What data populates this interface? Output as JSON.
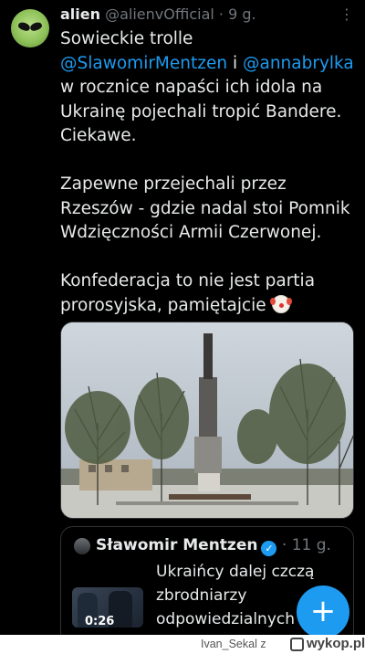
{
  "tweet": {
    "display_name": "alien",
    "handle": "@alienvOfficial",
    "separator": " · ",
    "time": "9 g.",
    "more_label": "⋮",
    "lines": {
      "l1": "Sowieckie trolle",
      "l2_mention1": "@SlawomirMentzen",
      "l2_and": " i ",
      "l2_mention2": "@annabrylka",
      "l3": "w rocznice napaści ich idola na",
      "l4": "Ukrainę pojechali tropić Bandere.",
      "l5": "Ciekawe.",
      "l6": "Zapewne przejechali przez",
      "l7": "Rzeszów - gdzie nadal stoi Pomnik",
      "l8": "Wdzięczności Armii Czerwonej.",
      "l9": "Konfederacja to nie jest partia",
      "l10": "prorosyjska, pamiętajcie "
    },
    "emoji_icon": "clown-face-icon"
  },
  "quote": {
    "display_name": "Sławomir Mentzen",
    "verified_icon": "verified-badge-icon",
    "verified_glyph": "✓",
    "separator": " · ",
    "time": "11 g.",
    "video_duration": "0:26",
    "lines": [
      "Ukraińcy dalej czczą",
      "zbrodniarzy",
      "odpowiedzialnych"
    ]
  },
  "fab": {
    "label": "+",
    "icon": "compose-plus-icon"
  },
  "watermark": {
    "user": "Ivan_Sekal z",
    "site": "wykop.pl"
  },
  "colors": {
    "background": "#000000",
    "text": "#e7e9ea",
    "muted": "#71767b",
    "accent": "#1d9bf0"
  }
}
